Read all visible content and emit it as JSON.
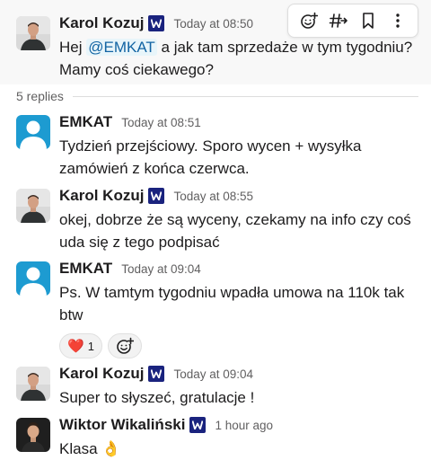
{
  "parent": {
    "author": "Karol Kozuj",
    "time": "Today at 08:50",
    "text_before": "Hej ",
    "mention": "@EMKAT",
    "text_after": " a jak tam sprzedaże w tym tygodniu? Mamy coś ciekawego?"
  },
  "actions": {
    "icons": [
      "add-reaction-icon",
      "reply-in-thread-icon",
      "bookmark-icon",
      "more-vertical-icon"
    ]
  },
  "replies_label": "5 replies",
  "replies": [
    {
      "author": "EMKAT",
      "time": "Today at 08:51",
      "text": "Tydzień przejściowy. Sporo wycen + wysyłka zamówień z końca czerwca."
    },
    {
      "author": "Karol Kozuj",
      "time": "Today at 08:55",
      "text": "okej, dobrze że są wyceny, czekamy na info czy coś uda się z tego podpisać"
    },
    {
      "author": "EMKAT",
      "time": "Today at 09:04",
      "text": "Ps. W tamtym tygodniu wpadła umowa na 110k tak btw",
      "reaction": {
        "emoji": "❤️",
        "count": "1"
      }
    },
    {
      "author": "Karol Kozuj",
      "time": "Today at 09:04",
      "text": "Super to słyszeć, gratulacje !"
    },
    {
      "author": "Wiktor Wikaliński",
      "time": "1 hour ago",
      "text": "Klasa 👌"
    }
  ],
  "colors": {
    "mention_bg": "#e8f5fa",
    "mention_text": "#1264a3",
    "badge": "#1a237e",
    "default_avatar": "#1d9bd1"
  }
}
